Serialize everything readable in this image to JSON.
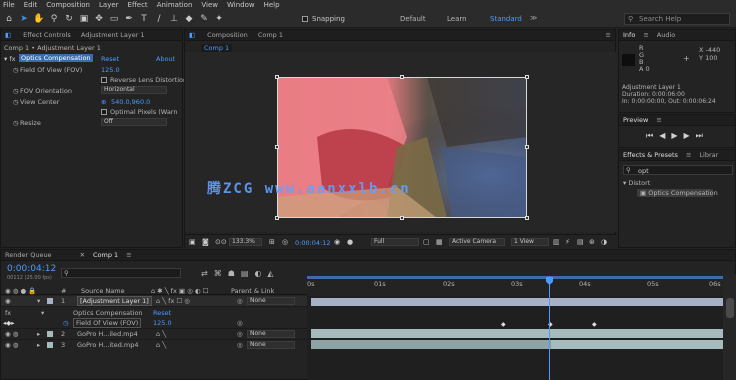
{
  "menu": [
    "File",
    "Edit",
    "Composition",
    "Layer",
    "Effect",
    "Animation",
    "View",
    "Window",
    "Help"
  ],
  "toolbar": {
    "snapping": "Snapping",
    "workspaces": [
      "Default",
      "Learn",
      "Standard"
    ],
    "active_workspace": "Standard",
    "search_placeholder": "Search Help"
  },
  "effect_controls": {
    "tab_label": "Effect Controls",
    "layer_name": "Adjustment Layer 1",
    "breadcrumb": "Comp 1 • Adjustment Layer 1",
    "effect_name": "Optics Compensation",
    "reset": "Reset",
    "about": "About",
    "params": [
      {
        "label": "Field Of View (FOV)",
        "value": "125.0"
      },
      {
        "label": "Reverse Lens Distortion",
        "value": ""
      },
      {
        "label": "FOV Orientation",
        "value": "Horizontal"
      },
      {
        "label": "View Center",
        "value": "540.0,960.0"
      },
      {
        "label": "Optimal Pixels (Warn",
        "value": ""
      },
      {
        "label": "Resize",
        "value": "Off"
      }
    ]
  },
  "composition": {
    "tab_label": "Composition",
    "comp_name": "Comp 1",
    "inner_tab": "Comp 1",
    "watermark": "腾ZCG www.aanxxlb.cn",
    "zoom": "133.3%",
    "timecode": "0:00:04:12",
    "resolution": "Full",
    "camera": "Active Camera",
    "views": "1 View"
  },
  "info": {
    "tabs": [
      "Info",
      "Audio"
    ],
    "r_label": "R",
    "g_label": "G",
    "b_label": "B",
    "a_label": "A",
    "a_value": "0",
    "x_label": "X",
    "x_value": "-440",
    "y_label": "Y",
    "y_value": "100",
    "layer": "Adjustment Layer 1",
    "duration": "Duration: 0:00:06:00",
    "in_out": "In: 0:00:00:00, Out: 0:00:06:24"
  },
  "preview": {
    "tab": "Preview"
  },
  "effects_presets": {
    "tabs": [
      "Effects & Presets",
      "Librar"
    ],
    "search_value": "opt",
    "category": "Distort",
    "item": "Optics Compensation"
  },
  "timeline": {
    "tabs": [
      "Render Queue",
      "Comp 1"
    ],
    "timecode": "0:00:04:12",
    "fps_line": "00112 (25.00 fps)",
    "search_placeholder": "",
    "columns": [
      "#",
      "Source Name",
      "Parent & Link"
    ],
    "layers": [
      {
        "num": "1",
        "name": "[Adjustment Layer 1]",
        "parent": "None"
      },
      {
        "num": "",
        "name": "Optics Compensation",
        "parent": "Reset"
      },
      {
        "num": "",
        "name": "Field Of View (FOV)",
        "parent": "125.0"
      },
      {
        "num": "2",
        "name": "GoPro H...iled.mp4",
        "parent": "None"
      },
      {
        "num": "3",
        "name": "GoPro H...ited.mp4",
        "parent": "None"
      }
    ],
    "ruler": [
      "0s",
      "01s",
      "02s",
      "03s",
      "04s",
      "05s",
      "06s"
    ],
    "playhead_fraction": 0.6
  },
  "colors": {
    "accent": "#4c9bff",
    "adj_layer_track": "#a9b1c8",
    "video_track": "#a6bcbc",
    "video_track_dim": "#8ea3a3"
  }
}
